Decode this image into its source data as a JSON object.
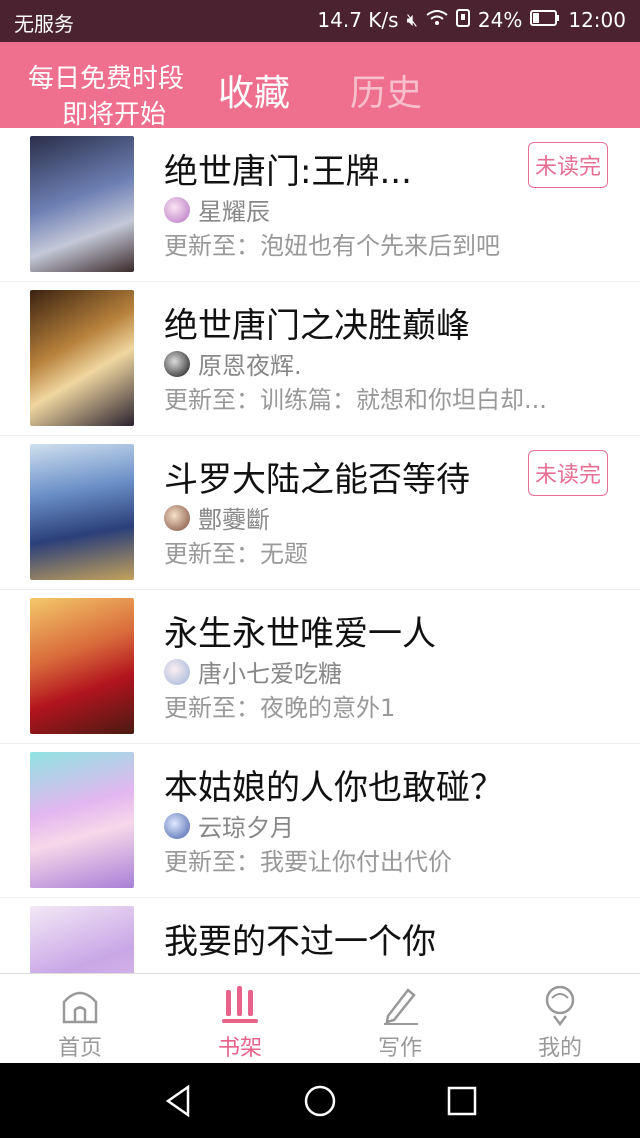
{
  "status_bar": {
    "carrier": "无服务",
    "network_speed": "14.7 K/s",
    "battery": "24%",
    "time": "12:00"
  },
  "header": {
    "free_banner_line1": "每日免费时段",
    "free_banner_line2": "即将开始",
    "tabs": [
      {
        "label": "收藏",
        "active": true
      },
      {
        "label": "历史",
        "active": false
      }
    ]
  },
  "colors": {
    "accent": "#ef6f8e",
    "accent_text": "#e8628a",
    "statusbar_bg": "#4a2230"
  },
  "books": [
    {
      "title": "绝世唐门:王牌...",
      "author": "星耀辰",
      "update": "更新至：泡妞也有个先来后到吧",
      "badge": "未读完"
    },
    {
      "title": "绝世唐门之决胜巅峰",
      "author": "原恩夜辉.",
      "update": "更新至：训练篇：就想和你坦白却...",
      "badge": ""
    },
    {
      "title": "斗罗大陆之能否等待",
      "author": "鄷虁斷",
      "update": "更新至：无题",
      "badge": "未读完"
    },
    {
      "title": "永生永世唯爱一人",
      "author": "唐小七爱吃糖",
      "update": "更新至：夜晚的意外1",
      "badge": ""
    },
    {
      "title": "本姑娘的人你也敢碰？",
      "author": "云琼夕月",
      "update": "更新至：我要让你付出代价",
      "badge": ""
    },
    {
      "title": "我要的不过一个你",
      "author": "",
      "update": "",
      "badge": ""
    }
  ],
  "bottom_nav": [
    {
      "label": "首页",
      "icon": "home-icon",
      "active": false
    },
    {
      "label": "书架",
      "icon": "bookshelf-icon",
      "active": true
    },
    {
      "label": "写作",
      "icon": "pencil-icon",
      "active": false
    },
    {
      "label": "我的",
      "icon": "profile-icon",
      "active": false
    }
  ]
}
